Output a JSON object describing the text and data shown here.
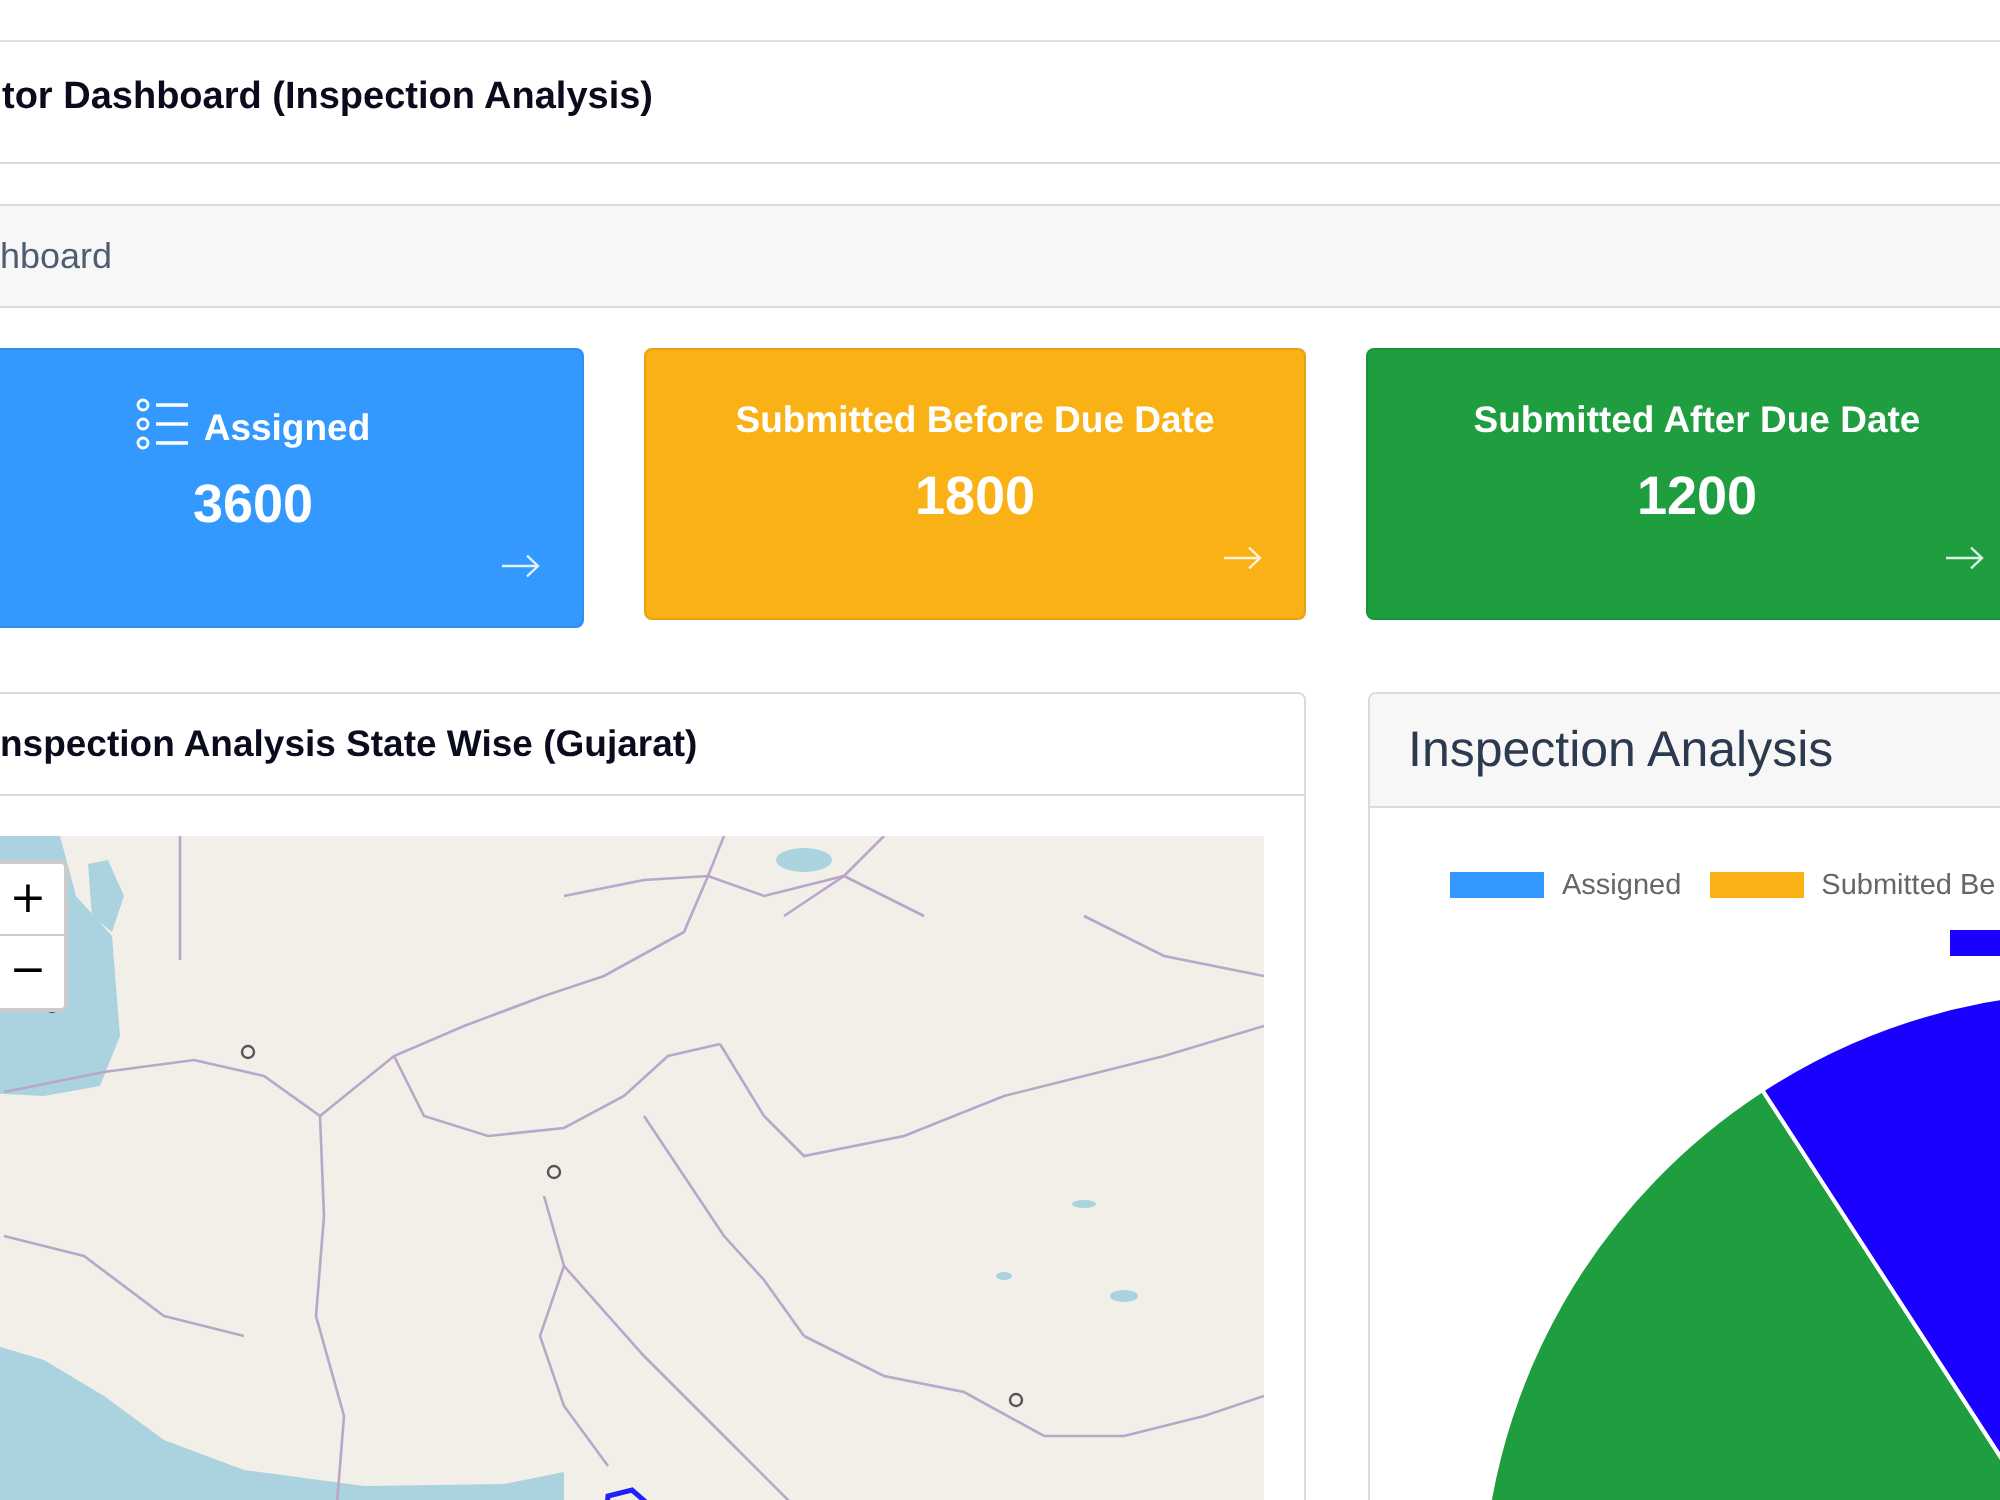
{
  "header": {
    "title": "tor Dashboard (Inspection Analysis)"
  },
  "breadcrumb": {
    "text": "hboard"
  },
  "cards": [
    {
      "title": "Assigned",
      "value": "3600",
      "color": "#3399ff",
      "icon": true
    },
    {
      "title": "Submitted Before Due Date",
      "value": "1800",
      "color": "#f9b115",
      "icon": false
    },
    {
      "title": "Submitted After Due Date",
      "value": "1200",
      "color": "#1e9e3e",
      "icon": false
    }
  ],
  "map_panel": {
    "title": "nspection Analysis State Wise (Gujarat)",
    "zoom_in": "+",
    "zoom_out": "−"
  },
  "chart_panel": {
    "title": "Inspection Analysis",
    "legend": [
      {
        "label": "Assigned",
        "color": "#3399ff"
      },
      {
        "label": "Submitted Be",
        "color": "#f9b115"
      },
      {
        "color": "#1a00ff"
      }
    ]
  }
}
